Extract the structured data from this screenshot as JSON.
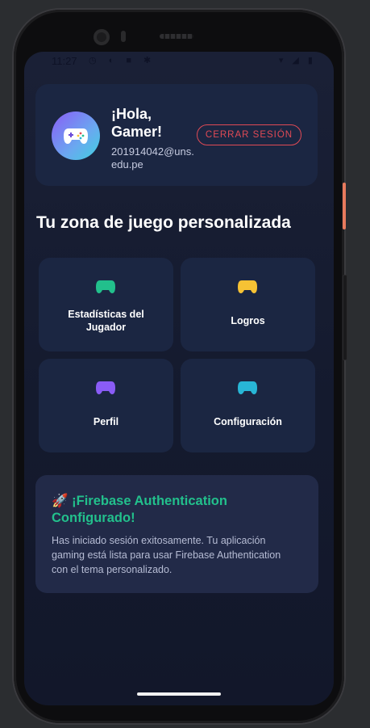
{
  "status_bar": {
    "time": "11:27",
    "left_icons": "◷ ◐ ■ ✱",
    "right_icons": "▾ ◢ ▮"
  },
  "header": {
    "greeting": "¡Hola, Gamer!",
    "email": "201914042@uns.edu.pe",
    "logout_label": "CERRAR SESIÓN"
  },
  "section_title": "Tu zona de juego personalizada",
  "tiles": [
    {
      "label": "Estadísticas del Jugador",
      "icon": "gamepad-icon",
      "color": "#22c08c"
    },
    {
      "label": "Logros",
      "icon": "gamepad-icon",
      "color": "#f6c234"
    },
    {
      "label": "Perfil",
      "icon": "gamepad-icon",
      "color": "#8a5cf6"
    },
    {
      "label": "Configuración",
      "icon": "gamepad-icon",
      "color": "#28b6d6"
    }
  ],
  "info": {
    "title": "🚀 ¡Firebase Authentication Configurado!",
    "body": "Has iniciado sesión exitosamente. Tu aplicación gaming está lista para usar Firebase Authentication con el tema personalizado."
  },
  "colors": {
    "accent_green": "#22c08c",
    "logout_red": "#e04a55",
    "card_bg": "#1b2642"
  }
}
